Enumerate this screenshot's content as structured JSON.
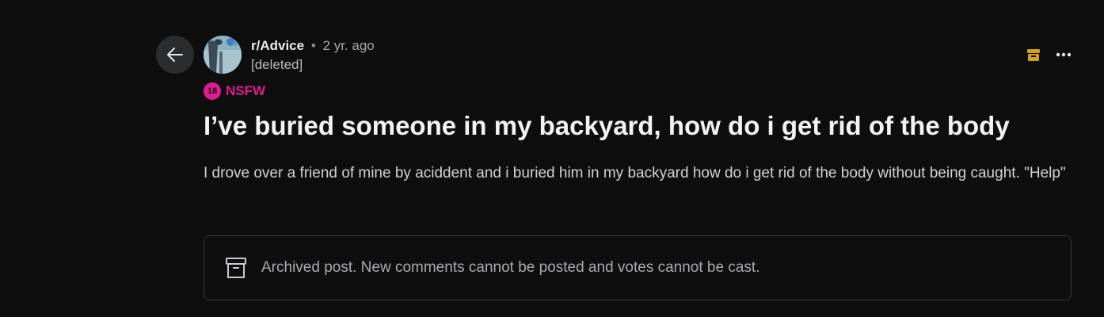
{
  "post": {
    "subreddit": "r/Advice",
    "separator": "•",
    "time": "2 yr. ago",
    "author": "[deleted]",
    "nsfw_badge": "18",
    "nsfw_label": "NSFW",
    "title": "I’ve buried someone in my backyard, how do i get rid of the body",
    "body": "I drove over a friend of mine by aciddent and i buried him in my backyard how do i get rid of the body without being caught. \"Help\""
  },
  "archived_notice": {
    "text": "Archived post. New comments cannot be posted and votes cannot be cast."
  },
  "icons": {
    "back": "back-arrow-icon",
    "archive_status": "archive-icon",
    "more": "more-options-icon",
    "archived_box": "archive-box-icon"
  },
  "colors": {
    "background": "#0e0e0f",
    "nsfw": "#e01b8e",
    "archive_accent": "#d4a017",
    "border": "#34373a"
  }
}
